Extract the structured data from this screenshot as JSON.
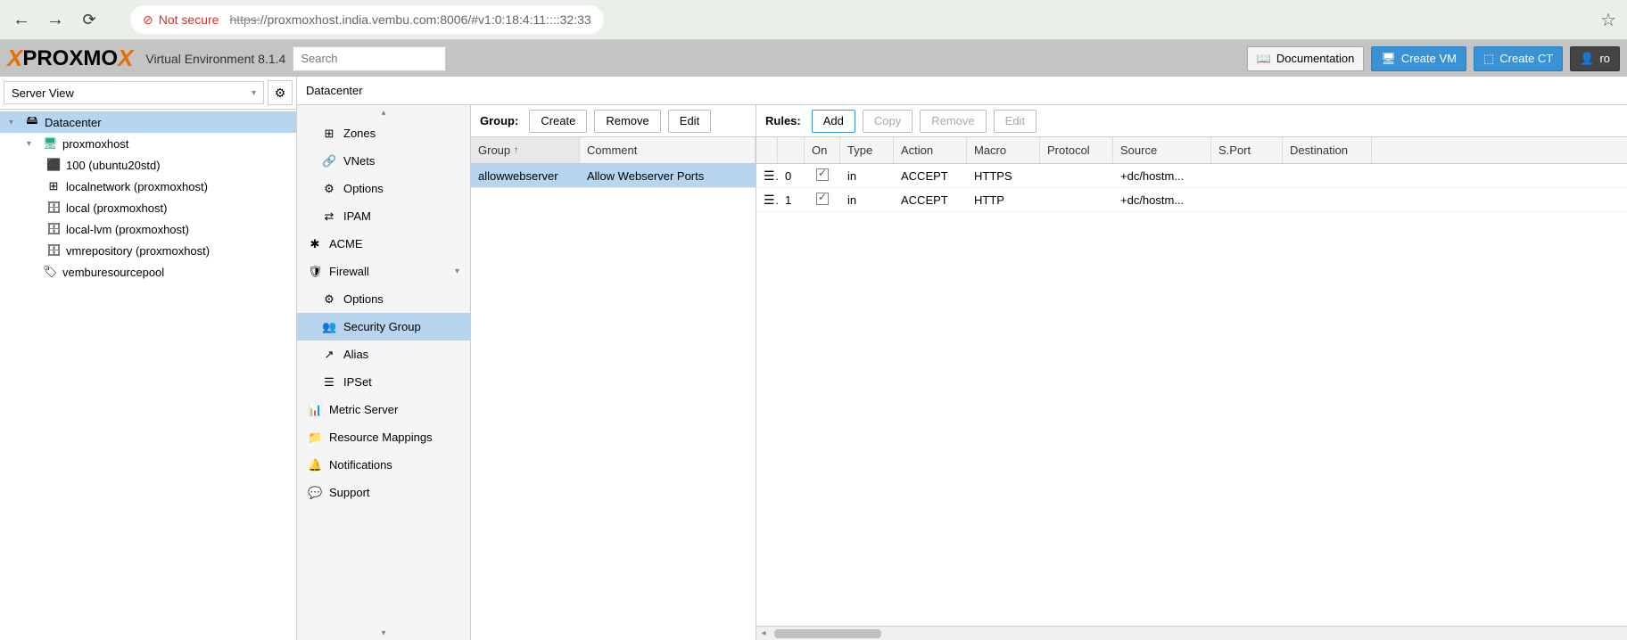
{
  "browser": {
    "not_secure": "Not secure",
    "url_scheme": "https:",
    "url_rest": "//proxmoxhost.india.vembu.com:8006/#v1:0:18:4:11::::32:33"
  },
  "header": {
    "logo": {
      "x1": "X",
      "text": "PROXMO",
      "x2": "X"
    },
    "env": "Virtual Environment 8.1.4",
    "search_placeholder": "Search",
    "doc": "Documentation",
    "create_vm": "Create VM",
    "create_ct": "Create CT",
    "user": "ro"
  },
  "view_selector": "Server View",
  "tree": {
    "datacenter": "Datacenter",
    "node": "proxmoxhost",
    "vm": "100 (ubuntu20std)",
    "sdn": "localnetwork (proxmoxhost)",
    "storage_local": "local (proxmoxhost)",
    "storage_lvm": "local-lvm (proxmoxhost)",
    "storage_vm": "vmrepository (proxmoxhost)",
    "pool": "vemburesourcepool"
  },
  "breadcrumb": "Datacenter",
  "menu": {
    "zones": "Zones",
    "vnets": "VNets",
    "options": "Options",
    "ipam": "IPAM",
    "acme": "ACME",
    "firewall": "Firewall",
    "fw_options": "Options",
    "sec_group": "Security Group",
    "alias": "Alias",
    "ipset": "IPSet",
    "metric": "Metric Server",
    "rmap": "Resource Mappings",
    "notif": "Notifications",
    "support": "Support"
  },
  "group_panel": {
    "label": "Group:",
    "create": "Create",
    "remove": "Remove",
    "edit": "Edit",
    "col_group": "Group",
    "col_comment": "Comment",
    "rows": [
      {
        "name": "allowwebserver",
        "comment": "Allow Webserver Ports"
      }
    ]
  },
  "rules_panel": {
    "label": "Rules:",
    "add": "Add",
    "copy": "Copy",
    "remove": "Remove",
    "edit": "Edit",
    "cols": {
      "on": "On",
      "type": "Type",
      "action": "Action",
      "macro": "Macro",
      "protocol": "Protocol",
      "source": "Source",
      "sport": "S.Port",
      "dest": "Destination"
    },
    "rows": [
      {
        "idx": "0",
        "on": true,
        "type": "in",
        "action": "ACCEPT",
        "macro": "HTTPS",
        "protocol": "",
        "source": "+dc/hostm...",
        "sport": "",
        "dest": ""
      },
      {
        "idx": "1",
        "on": true,
        "type": "in",
        "action": "ACCEPT",
        "macro": "HTTP",
        "protocol": "",
        "source": "+dc/hostm...",
        "sport": "",
        "dest": ""
      }
    ]
  }
}
